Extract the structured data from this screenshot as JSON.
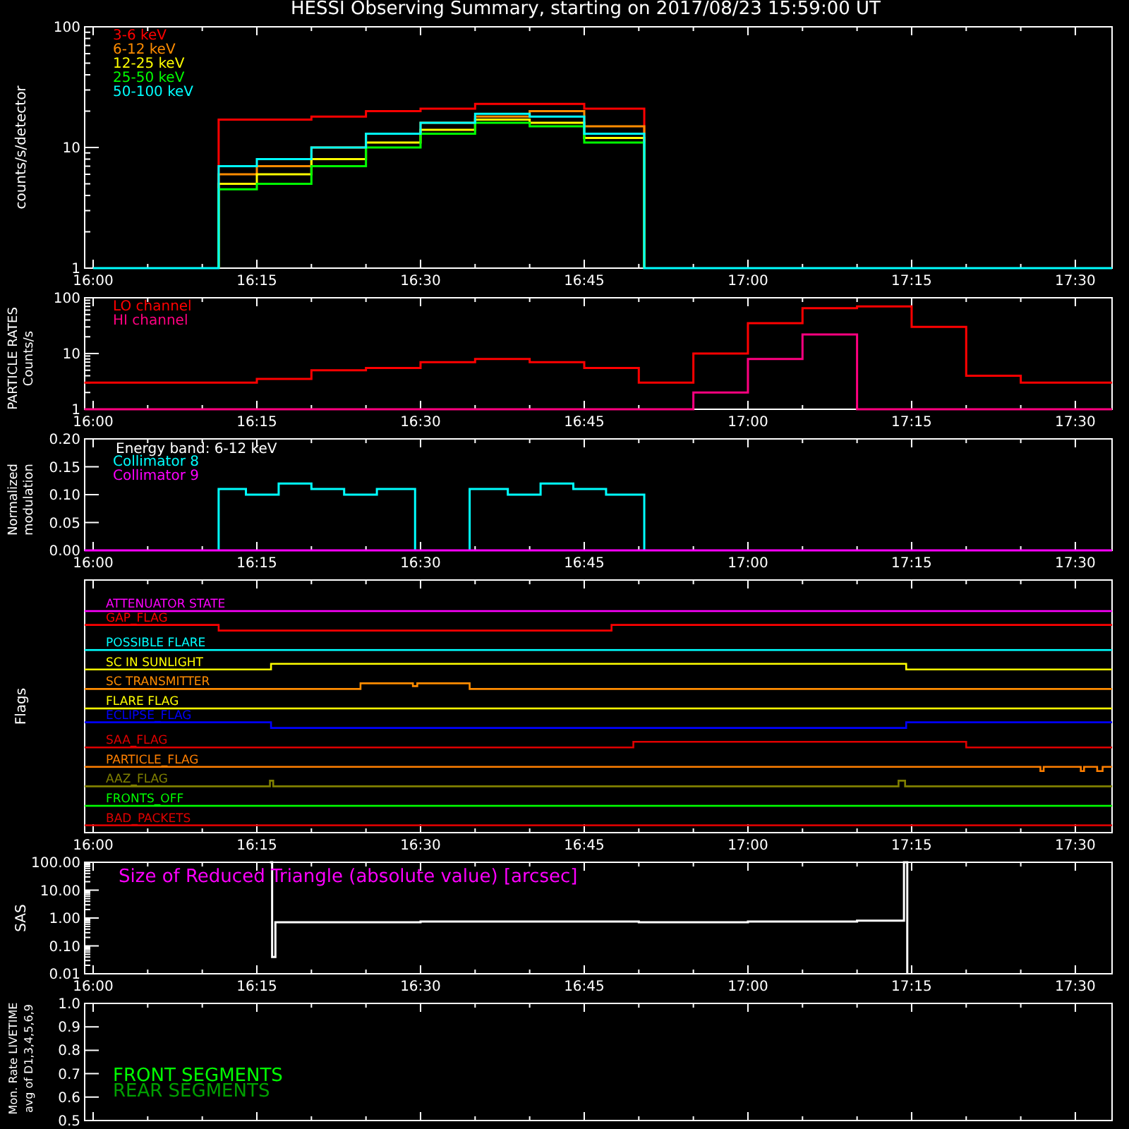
{
  "title": "HESSI Observing Summary, starting on 2017/08/23 15:59:00 UT",
  "panels": [
    {
      "kind": "plot",
      "ylabel_lines": [
        "counts/s/detector"
      ],
      "y_labels": [
        "100",
        "10",
        "1"
      ],
      "x_labels": [
        "16:00",
        "16:15",
        "16:30",
        "16:45",
        "17:00",
        "17:15",
        "17:30"
      ],
      "legend": [
        {
          "label": "3-6 keV",
          "color": "#ff0000"
        },
        {
          "label": "6-12 keV",
          "color": "#ff8c00"
        },
        {
          "label": "12-25 keV",
          "color": "#ffff00"
        },
        {
          "label": "25-50 keV",
          "color": "#00ff00"
        },
        {
          "label": "50-100 keV",
          "color": "#00ffff"
        }
      ]
    },
    {
      "kind": "plot",
      "ylabel_lines": [
        "PARTICLE RATES",
        "Counts/s"
      ],
      "y_labels": [
        "100",
        "10",
        "1"
      ],
      "x_labels": [
        "16:00",
        "16:15",
        "16:30",
        "16:45",
        "17:00",
        "17:15",
        "17:30"
      ],
      "legend": [
        {
          "label": "LO channel",
          "color": "#ff0000"
        },
        {
          "label": "HI channel",
          "color": "#ff0080"
        }
      ]
    },
    {
      "kind": "plot",
      "ylabel_lines": [
        "Normalized",
        "modulation"
      ],
      "note": "Energy band: 6-12 keV",
      "y_labels": [
        "0.20",
        "0.15",
        "0.10",
        "0.05",
        "0.00"
      ],
      "x_labels": [
        "16:00",
        "16:15",
        "16:30",
        "16:45",
        "17:00",
        "17:15",
        "17:30"
      ],
      "legend": [
        {
          "label": "Collimator 8",
          "color": "#00ffff"
        },
        {
          "label": "Collimator 9",
          "color": "#ff00ff"
        }
      ]
    },
    {
      "kind": "flags",
      "ylabel_lines": [
        "Flags"
      ],
      "x_labels": [
        "16:00",
        "16:15",
        "16:30",
        "16:45",
        "17:00",
        "17:15",
        "17:30"
      ],
      "flags": [
        {
          "label": "ATTENUATOR STATE",
          "color": "#ff00ff"
        },
        {
          "label": "GAP_FLAG",
          "color": "#ff0000"
        },
        {
          "label": "POSSIBLE FLARE",
          "color": "#00ffff"
        },
        {
          "label": "SC IN SUNLIGHT",
          "color": "#ffff00"
        },
        {
          "label": "SC TRANSMITTER",
          "color": "#ff8c00"
        },
        {
          "label": "FLARE FLAG",
          "color": "#ffff00"
        },
        {
          "label": "ECLIPSE_FLAG",
          "color": "#0000ff"
        },
        {
          "label": "SAA_FLAG",
          "color": "#e00000"
        },
        {
          "label": "PARTICLE_FLAG",
          "color": "#ff7f00"
        },
        {
          "label": "AAZ_FLAG",
          "color": "#808000"
        },
        {
          "label": "FRONTS_OFF",
          "color": "#00ff00"
        },
        {
          "label": "BAD_PACKETS",
          "color": "#e00000"
        }
      ]
    },
    {
      "kind": "plot",
      "ylabel_lines": [
        "SAS"
      ],
      "annotation": "Size of Reduced Triangle (absolute value) [arcsec]",
      "y_labels": [
        "100.00",
        "10.00",
        "1.00",
        "0.10",
        "0.01"
      ],
      "x_labels": [
        "16:00",
        "16:15",
        "16:30",
        "16:45",
        "17:00",
        "17:15",
        "17:30"
      ]
    },
    {
      "kind": "plot",
      "ylabel_lines": [
        "Mon. Rate LIVETIME",
        "avg of D1,3,4,5,6,9"
      ],
      "y_labels": [
        "1.0",
        "0.9",
        "0.8",
        "0.7",
        "0.6",
        "0.5"
      ],
      "legend": [
        {
          "label": "FRONT SEGMENTS",
          "color": "#00ff00"
        },
        {
          "label": "REAR SEGMENTS",
          "color": "#00a000"
        }
      ]
    }
  ]
}
